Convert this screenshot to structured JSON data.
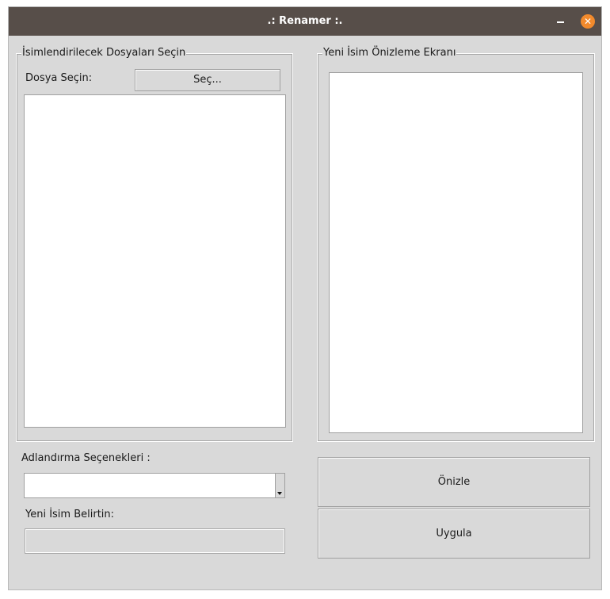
{
  "window": {
    "title": ".: Renamer :."
  },
  "left_group": {
    "title": "İsimlendirilecek Dosyaları Seçin",
    "file_label": "Dosya Seçin:",
    "select_button": "Seç..."
  },
  "right_group": {
    "title": "Yeni İsim Önizleme Ekranı"
  },
  "options": {
    "naming_label": "Adlandırma Seçenekleri :",
    "naming_value": "",
    "new_name_label": "Yeni İsim Belirtin:",
    "new_name_value": ""
  },
  "actions": {
    "preview_button": "Önizle",
    "apply_button": "Uygula"
  }
}
